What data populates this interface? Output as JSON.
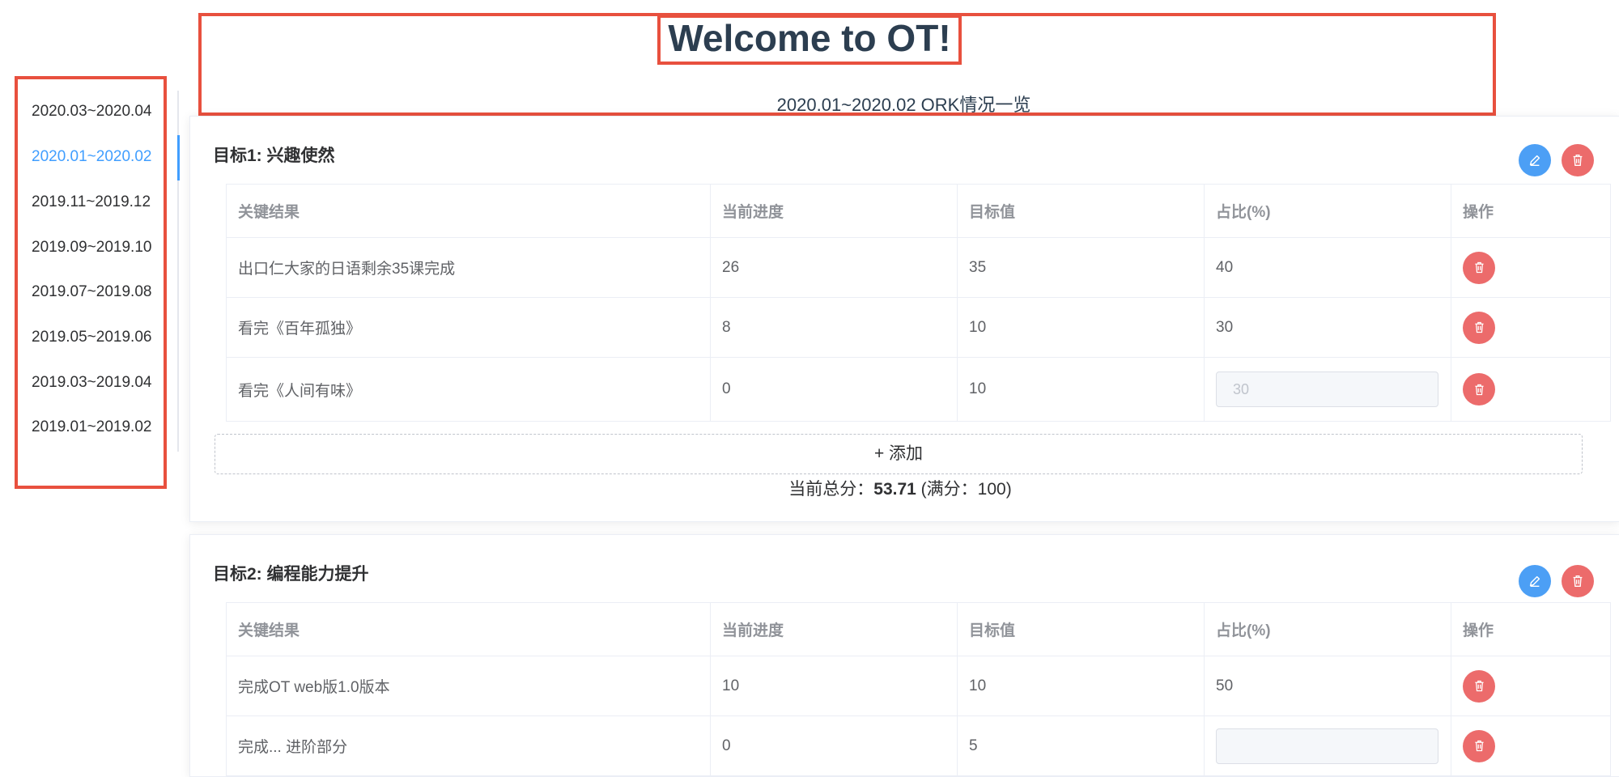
{
  "header": {
    "title": "Welcome to OT!",
    "subtitle": "2020.01~2020.02 ORK情况一览"
  },
  "sidebar": {
    "active_index": 1,
    "items": [
      {
        "label": "2020.03~2020.04"
      },
      {
        "label": "2020.01~2020.02"
      },
      {
        "label": "2019.11~2019.12"
      },
      {
        "label": "2019.09~2019.10"
      },
      {
        "label": "2019.07~2019.08"
      },
      {
        "label": "2019.05~2019.06"
      },
      {
        "label": "2019.03~2019.04"
      },
      {
        "label": "2019.01~2019.02"
      }
    ]
  },
  "table_headers": {
    "key_result": "关键结果",
    "progress": "当前进度",
    "target": "目标值",
    "ratio": "占比(%)",
    "action": "操作"
  },
  "goals": [
    {
      "title": "目标1: 兴趣使然",
      "rows": [
        {
          "key_result": "出口仁大家的日语剩余35课完成",
          "progress": "26",
          "target": "35",
          "ratio": "40"
        },
        {
          "key_result": "看完《百年孤独》",
          "progress": "8",
          "target": "10",
          "ratio": "30"
        },
        {
          "key_result": "看完《人间有味》",
          "progress": "0",
          "target": "10",
          "ratio_input": "30"
        }
      ],
      "add_label": "+ 添加",
      "score_prefix": "当前总分：",
      "score_value": "53.71",
      "score_suffix": " (满分：100)"
    },
    {
      "title": "目标2: 编程能力提升",
      "rows": [
        {
          "key_result": "完成OT web版1.0版本",
          "progress": "10",
          "target": "10",
          "ratio": "50"
        },
        {
          "key_result": "完成... 进阶部分",
          "progress": "0",
          "target": "5",
          "ratio_input": ""
        }
      ]
    }
  ],
  "colors": {
    "accent": "#409eff",
    "danger": "#ec6b6b",
    "highlight_border": "#e8503e"
  }
}
